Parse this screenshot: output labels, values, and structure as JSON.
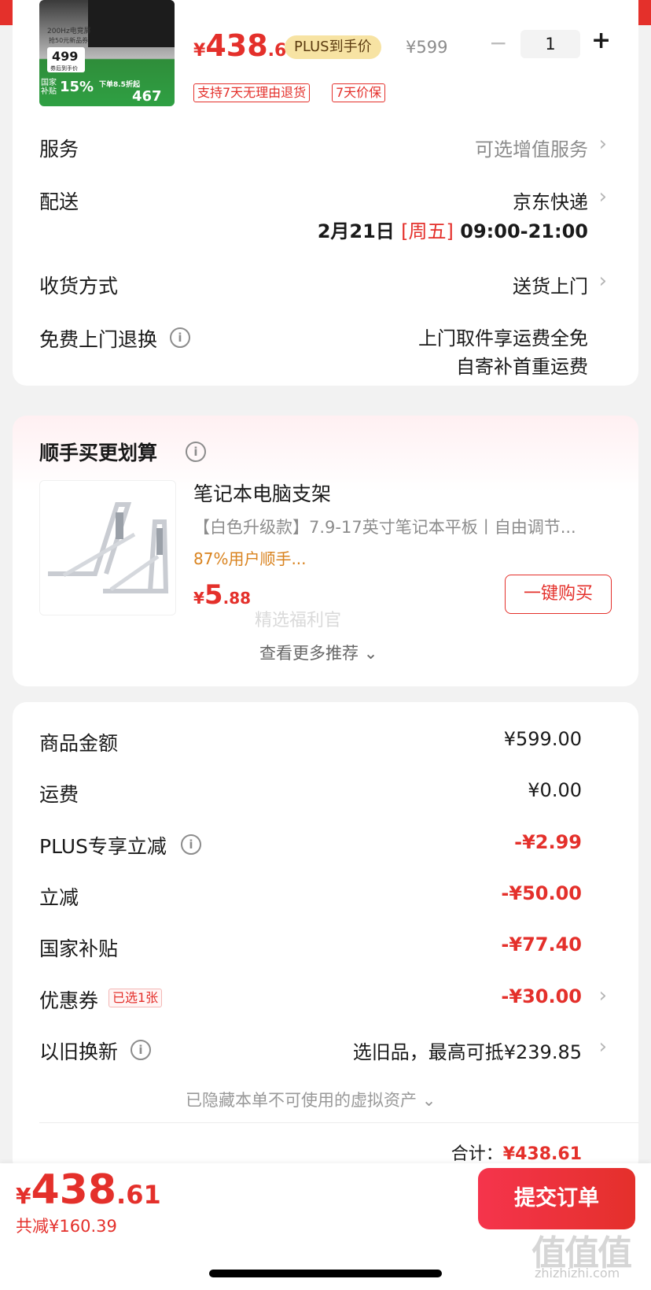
{
  "product": {
    "thumb_texts": [
      "200Hz电竞屏",
      "抢50元新品券",
      "499",
      "券后到手价",
      "国家补贴",
      "15%",
      "下单8.5折起",
      "467"
    ],
    "price_int": "438",
    "price_dec": ".61",
    "currency": "¥",
    "plus_label": "PLUS到手价",
    "original_price": "¥599",
    "quantity": "1",
    "minus": "−",
    "plus": "+",
    "tags": [
      "支持7天无理由退货",
      "7天价保"
    ]
  },
  "service": {
    "label": "服务",
    "value": "可选增值服务"
  },
  "delivery": {
    "label": "配送",
    "carrier": "京东快递",
    "date": "2月21日",
    "weekday": "[周五]",
    "time": "09:00-21:00"
  },
  "receive": {
    "label": "收货方式",
    "value": "送货上门"
  },
  "free_return": {
    "label": "免费上门退换",
    "line1": "上门取件享运费全免",
    "line2": "自寄补首重运费"
  },
  "bundle": {
    "title": "顺手买更划算",
    "item_name": "笔记本电脑支架",
    "item_desc": "【白色升级款】7.9-17英寸笔记本平板丨自由调节...",
    "item_rate": "87%用户顺手...",
    "item_price_int": "5",
    "item_price_dec": ".88",
    "buy_button": "一键购买",
    "watermark": "精选福利官",
    "more": "查看更多推荐"
  },
  "summary": {
    "rows": [
      {
        "label": "商品金额",
        "value": "¥599.00"
      },
      {
        "label": "运费",
        "value": "¥0.00"
      },
      {
        "label": "PLUS专享立减",
        "value": "-¥2.99"
      },
      {
        "label": "立减",
        "value": "-¥50.00"
      },
      {
        "label": "国家补贴",
        "value": "-¥77.40"
      },
      {
        "label": "优惠券",
        "value": "-¥30.00",
        "badge": "已选1张"
      },
      {
        "label": "以旧换新",
        "value": "选旧品，最高可抵¥239.85"
      }
    ],
    "hidden_assets": "已隐藏本单不可使用的虚拟资产",
    "total_label": "合计：",
    "total_value": "¥438.61"
  },
  "footer": {
    "currency": "¥",
    "price_int": "438",
    "price_dec": ".61",
    "saved": "共减¥160.39",
    "submit": "提交订单",
    "logo_text": "值值值",
    "logo_url": "zhizhizhi.com"
  },
  "colors": {
    "accent": "#e4302b",
    "plus_badge": "#f7e3a3",
    "orange_text": "#d9831f"
  }
}
